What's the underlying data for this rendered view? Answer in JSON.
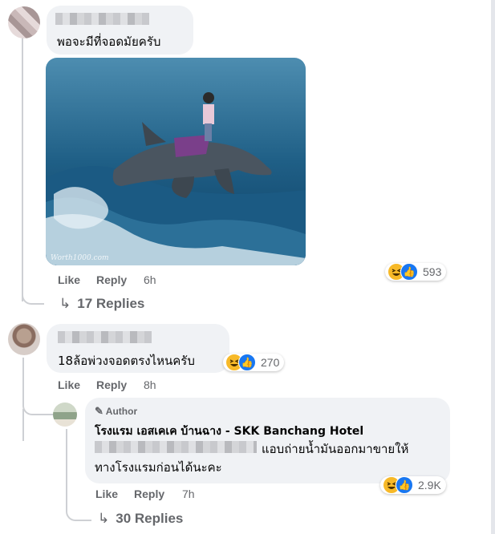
{
  "comments": [
    {
      "text": "พอจะมีที่จอดมัยครับ",
      "image_watermark": "Worth1000.com",
      "actions": {
        "like": "Like",
        "reply": "Reply",
        "time": "6h"
      },
      "reactions": {
        "icons": [
          "haha-icon",
          "like-icon"
        ],
        "count": "593"
      },
      "replies_link": "17 Replies"
    },
    {
      "text": "18ล้อพ่วงจอดตรงไหนครับ",
      "actions": {
        "like": "Like",
        "reply": "Reply",
        "time": "8h"
      },
      "reactions": {
        "icons": [
          "haha-icon",
          "like-icon"
        ],
        "count": "270"
      },
      "reply": {
        "badge": "Author",
        "author": "โรงแรม เอสเคเค บ้านฉาง - SKK Banchang Hotel",
        "text_line1": "แอบถ่ายน้ำมันออกมาขายให้",
        "text_line2": "ทางโรงแรมก่อนได้นะคะ",
        "actions": {
          "like": "Like",
          "reply": "Reply",
          "time": "7h"
        },
        "reactions": {
          "icons": [
            "haha-icon",
            "like-icon"
          ],
          "count": "2.9K"
        }
      },
      "replies_link": "30 Replies"
    }
  ],
  "colors": {
    "bubble": "#f0f2f5",
    "secondary_text": "#65676b",
    "like_blue": "#1877f2",
    "haha_yellow": "#f7b928"
  }
}
